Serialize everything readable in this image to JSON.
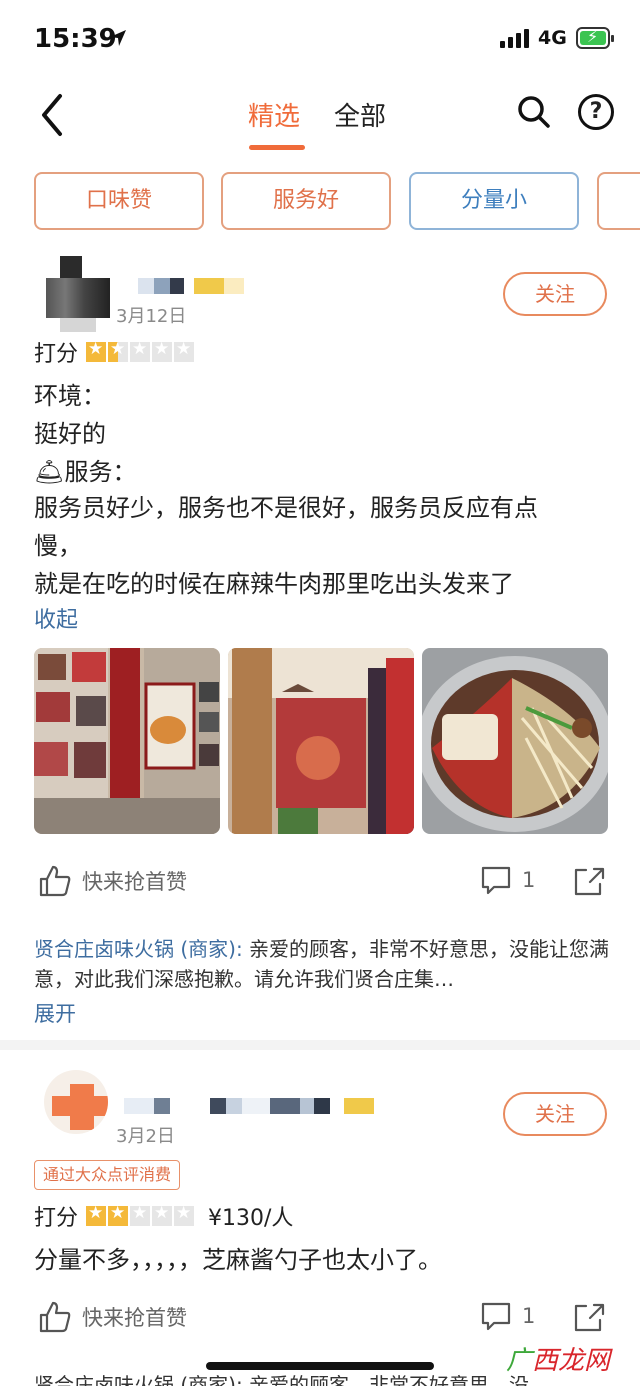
{
  "status_bar": {
    "time": "15:39",
    "network": "4G"
  },
  "nav": {
    "tab_active": "精选",
    "tab_other": "全部"
  },
  "chips": [
    "口味赞",
    "服务好",
    "分量小"
  ],
  "reviews": [
    {
      "date": "3月12日",
      "follow": "关注",
      "rating_label": "打分",
      "stars": 1.5,
      "lines": [
        "环境：",
        "挺好的",
        "🛎服务：",
        "服务员好少，服务也不是很好，服务员反应有点",
        "慢，",
        "就是在吃的时候在麻辣牛肉那里吃出头发来了"
      ],
      "collapse": "收起",
      "like_label": "快来抢首赞",
      "comment_count": "1",
      "reply_shop": "贤合庄卤味火锅 (商家):",
      "reply_text": " 亲爱的顾客，非常不好意思，没能让您满意，对此我们深感抱歉。请允许我们贤合庄集…",
      "expand": "展开"
    },
    {
      "date": "3月2日",
      "follow": "关注",
      "badge": "通过大众点评消费",
      "rating_label": "打分",
      "stars": 2,
      "price": "¥130/人",
      "text": "分量不多，，，，，芝麻酱勺子也太小了。",
      "like_label": "快来抢首赞",
      "comment_count": "1",
      "reply_partial": "贤合庄卤味火锅 (商家): 亲爱的顾客，非常不好意思，没"
    }
  ],
  "watermark": {
    "leaf": "广",
    "text": "西龙网"
  }
}
